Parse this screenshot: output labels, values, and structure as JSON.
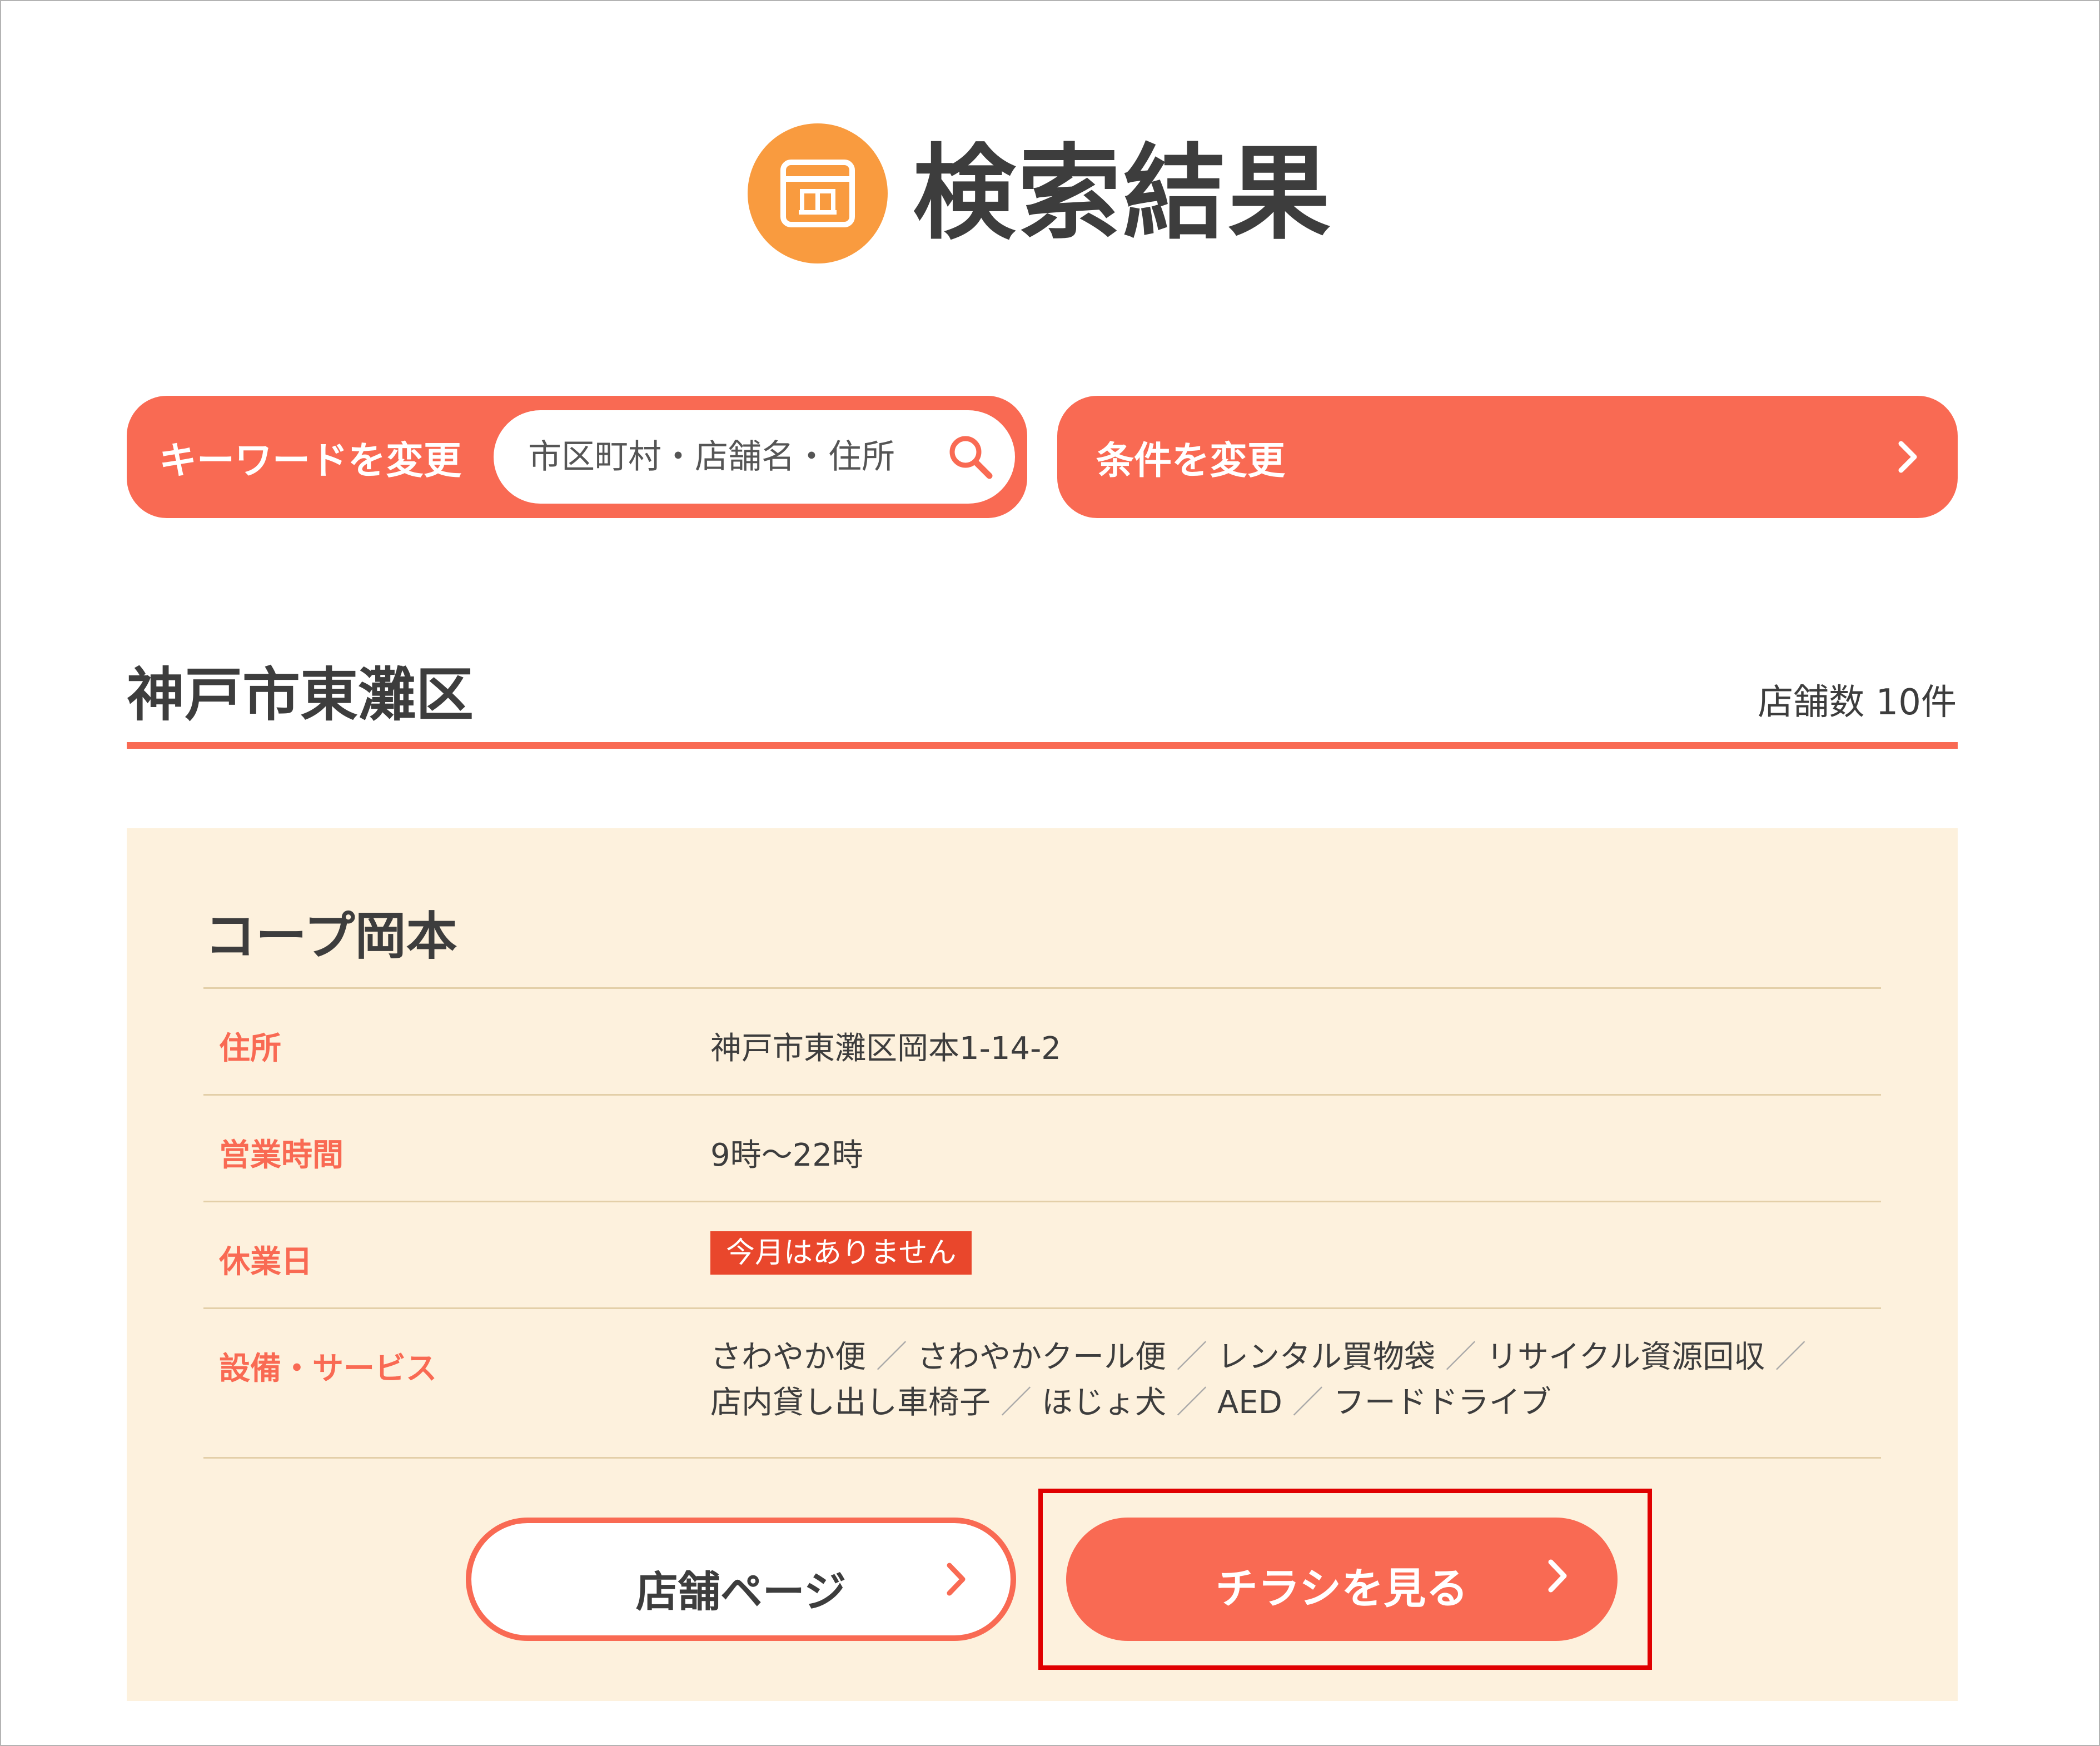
{
  "header": {
    "title": "検索結果",
    "icon": "calendar-icon",
    "icon_bg": "#f99b3f"
  },
  "search": {
    "keyword_label": "キーワードを変更",
    "placeholder": "市区町村・店舗名・住所",
    "value": "",
    "condition_label": "条件を変更"
  },
  "area": {
    "title": "神戸市東灘区",
    "count_label": "店舗数 10件"
  },
  "store": {
    "name": "コープ岡本",
    "rows": {
      "address": {
        "label": "住所",
        "value": "神戸市東灘区岡本1-14-2"
      },
      "hours": {
        "label": "営業時間",
        "value": "9時～22時"
      },
      "closed": {
        "label": "休業日",
        "badge": "今月はありません"
      },
      "services": {
        "label": "設備・サービス",
        "items": [
          "さわやか便",
          "さわやかクール便",
          "レンタル買物袋",
          "リサイクル資源回収",
          "店内貸し出し車椅子",
          "ほじょ犬",
          "AED",
          "フードドライブ"
        ],
        "separator": "／"
      }
    },
    "buttons": {
      "store_page": "店舗ページ",
      "flyer": "チラシを見る"
    }
  },
  "colors": {
    "accent": "#f96a53",
    "card_bg": "#fdf1dd",
    "badge": "#e9472c",
    "highlight": "#e00000"
  }
}
